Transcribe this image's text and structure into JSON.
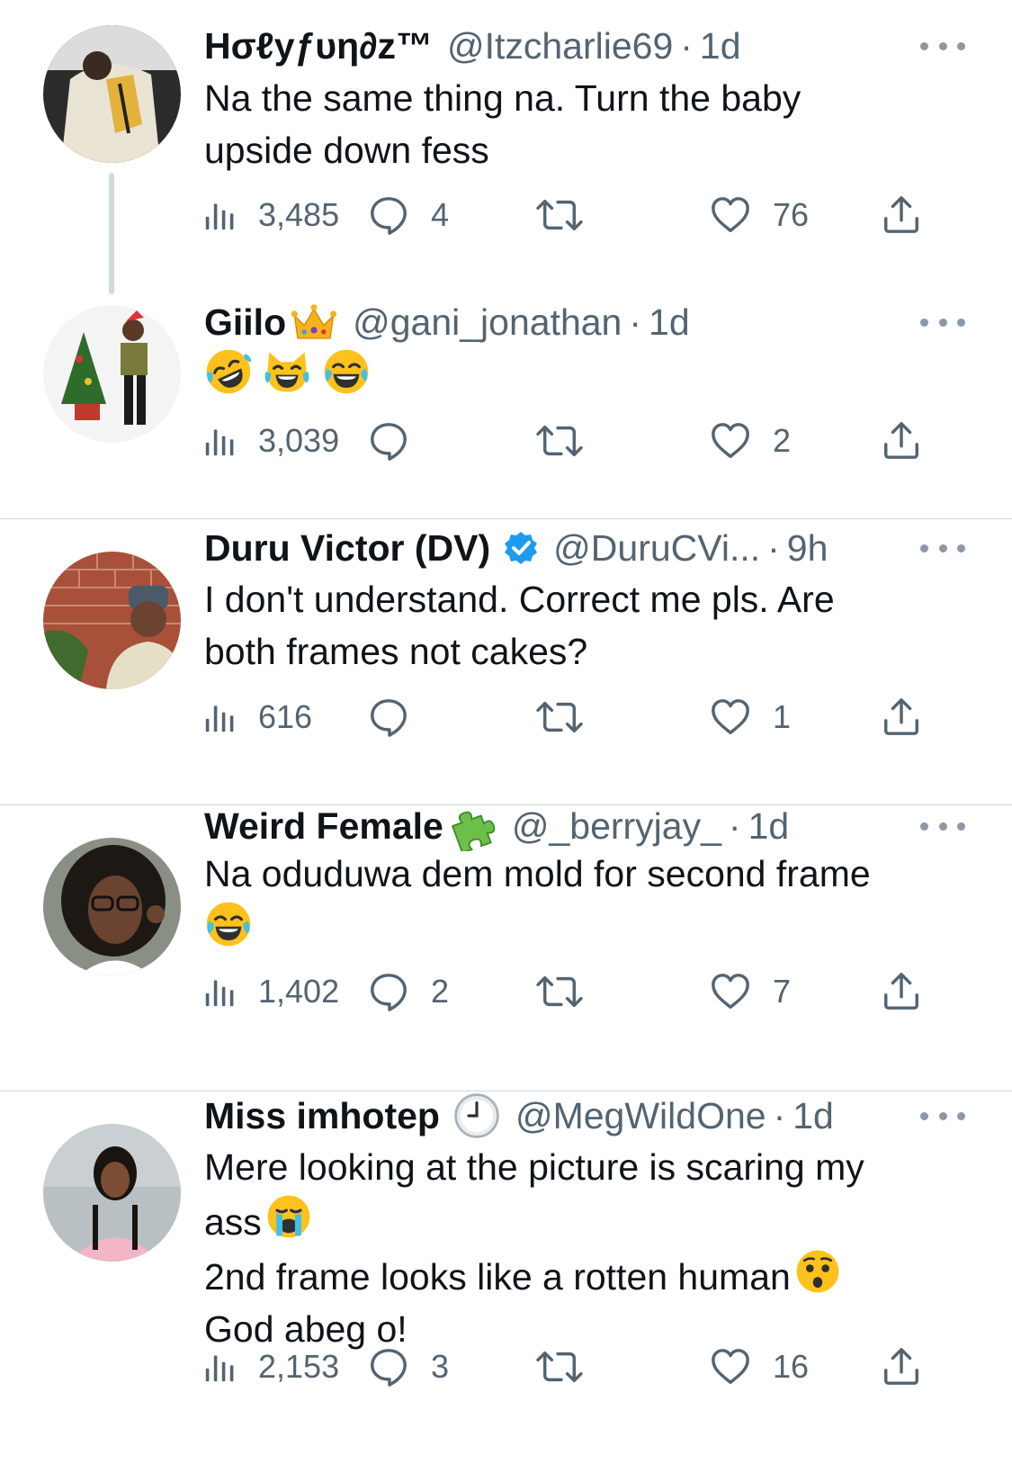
{
  "tweets": [
    {
      "name": "Hσℓуƒυη∂z™",
      "handle": "@Itzcharlie69",
      "separator": "·",
      "time": "1d",
      "lines": [
        "Na the same thing na. Turn the baby",
        "upside down fess"
      ],
      "views": "3,485",
      "replies": "4",
      "retweets": "",
      "likes": "76"
    },
    {
      "name": "Giilo",
      "name_emoji": "crown",
      "handle": "@gani_jonathan",
      "separator": "·",
      "time": "1d",
      "emojis": [
        "rolling-on-floor-laughing",
        "cat-tears-of-joy",
        "tears-of-joy"
      ],
      "views": "3,039",
      "replies": "",
      "retweets": "",
      "likes": "2"
    },
    {
      "name": "Duru Victor (DV)",
      "verified": true,
      "handle": "@DuruCVi...",
      "separator": "·",
      "time": "9h",
      "lines": [
        "I don't understand. Correct me pls. Are",
        "both frames not cakes?"
      ],
      "views": "616",
      "replies": "",
      "retweets": "",
      "likes": "1"
    },
    {
      "name": "Weird Female",
      "name_emoji": "puzzle-piece",
      "handle": "@_berryjay_",
      "separator": "·",
      "time": "1d",
      "lines": [
        "Na oduduwa dem mold for second frame"
      ],
      "trailing_emoji": "tears-of-joy",
      "views": "1,402",
      "replies": "2",
      "retweets": "",
      "likes": "7"
    },
    {
      "name": "Miss imhotep",
      "name_emoji": "clock",
      "handle": "@MegWildOne",
      "separator": "·",
      "time": "1d",
      "lines": [
        "Mere looking at the picture is scaring my",
        "ass",
        "2nd frame looks like a rotten human",
        "God abeg o!"
      ],
      "views": "2,153",
      "replies": "3",
      "retweets": "",
      "likes": "16"
    }
  ],
  "colors": {
    "text": "#0f1419",
    "secondary": "#536471",
    "verified": "#1d9bf0",
    "divider": "#cfd9de"
  }
}
